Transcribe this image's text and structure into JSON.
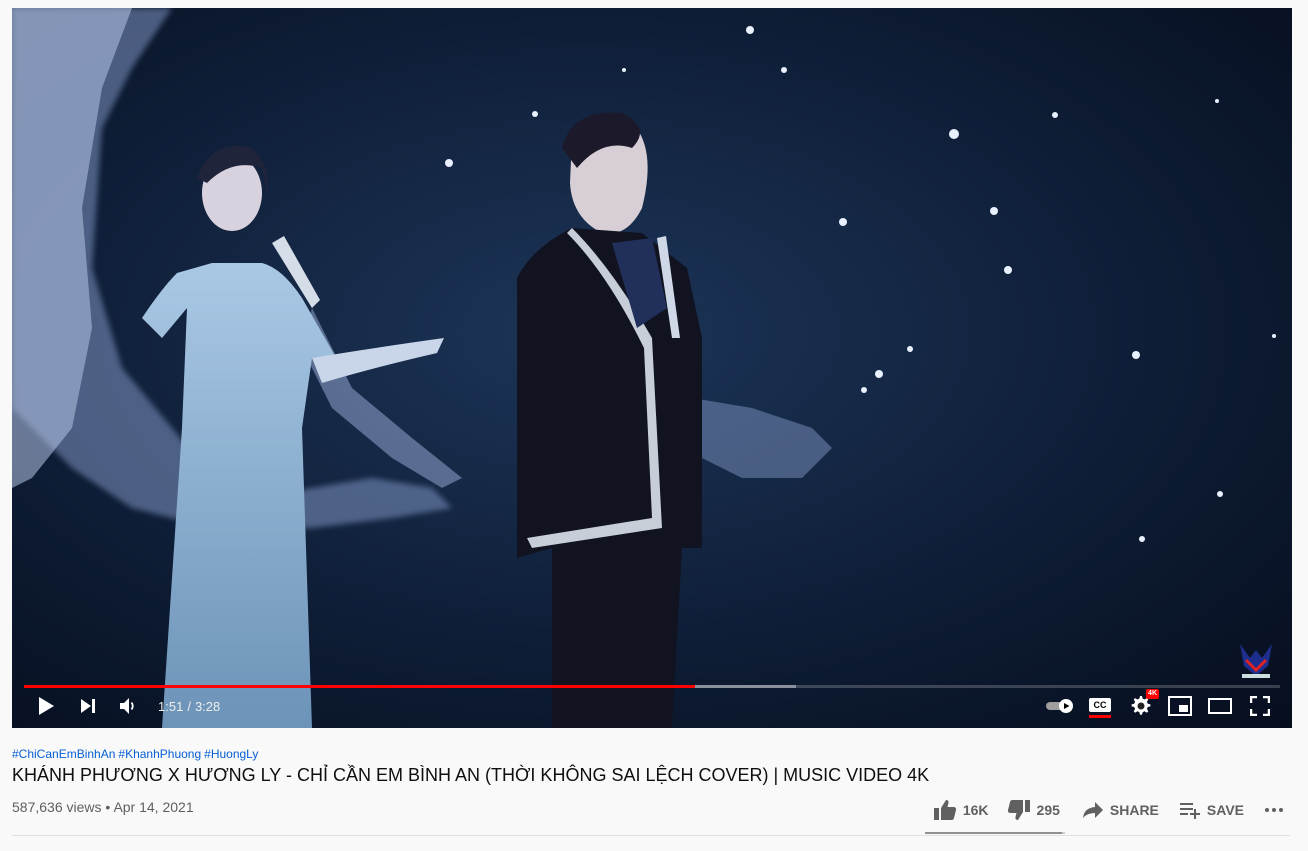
{
  "player": {
    "current_time": "1:51",
    "duration": "3:28",
    "time_separator": "/",
    "played_fraction": 0.534,
    "buffered_fraction": 0.615,
    "cc_label": "CC",
    "quality_badge": "4K",
    "autoplay_on": true,
    "accent_color": "#ff0000"
  },
  "video": {
    "hashtags": [
      "#ChiCanEmBinhAn",
      "#KhanhPhuong",
      "#HuongLy"
    ],
    "title": "KHÁNH PHƯƠNG X HƯƠNG LY - CHỈ CẦN EM BÌNH AN (THỜI KHÔNG SAI LỆCH COVER) | MUSIC VIDEO 4K",
    "views": "587,636 views",
    "bullet": "•",
    "date": "Apr 14, 2021"
  },
  "actions": {
    "likes": "16K",
    "dislikes": "295",
    "share_label": "SHARE",
    "save_label": "SAVE",
    "like_fraction": 0.982
  },
  "icons": [
    "play-icon",
    "next-icon",
    "volume-icon",
    "autoplay-toggle-icon",
    "cc-icon",
    "settings-icon",
    "miniplayer-icon",
    "theater-icon",
    "fullscreen-icon",
    "like-icon",
    "dislike-icon",
    "share-icon",
    "save-icon",
    "more-icon"
  ]
}
